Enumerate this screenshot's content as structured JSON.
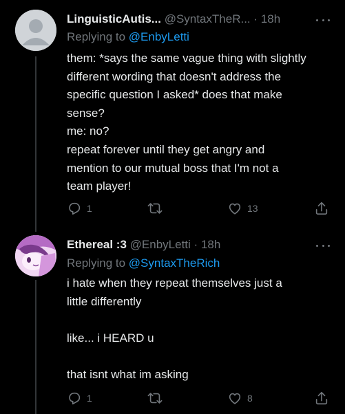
{
  "tweets": [
    {
      "display_name": "LinguisticAutis...",
      "handle": "@SyntaxTheR...",
      "separator": "·",
      "time": "18h",
      "replying_label": "Replying to",
      "replying_to": "@EnbyLetti",
      "lines": [
        "them: *says the same vague thing with slightly",
        "different wording that doesn't address the",
        "specific question I asked* does that make",
        "sense?",
        "me: no?",
        "repeat forever until they get angry and",
        "mention to our mutual boss that I'm not a",
        "team player!"
      ],
      "reply_count": "1",
      "retweet_count": "",
      "like_count": "13",
      "avatar_icon": "default-profile-silhouette"
    },
    {
      "display_name": "Ethereal :3",
      "handle": "@EnbyLetti",
      "separator": "·",
      "time": "18h",
      "replying_label": "Replying to",
      "replying_to": "@SyntaxTheRich",
      "lines": [
        "i hate when they repeat themselves just a",
        "little differently",
        "",
        "like... i HEARD u",
        "",
        "that isnt what im asking"
      ],
      "reply_count": "1",
      "retweet_count": "",
      "like_count": "8",
      "avatar_icon": "anime-character-artwork"
    }
  ],
  "colors": {
    "background": "#000000",
    "text": "#e7e9ea",
    "secondary": "#71767b",
    "link": "#1d9bf0",
    "divider": "#333639"
  }
}
